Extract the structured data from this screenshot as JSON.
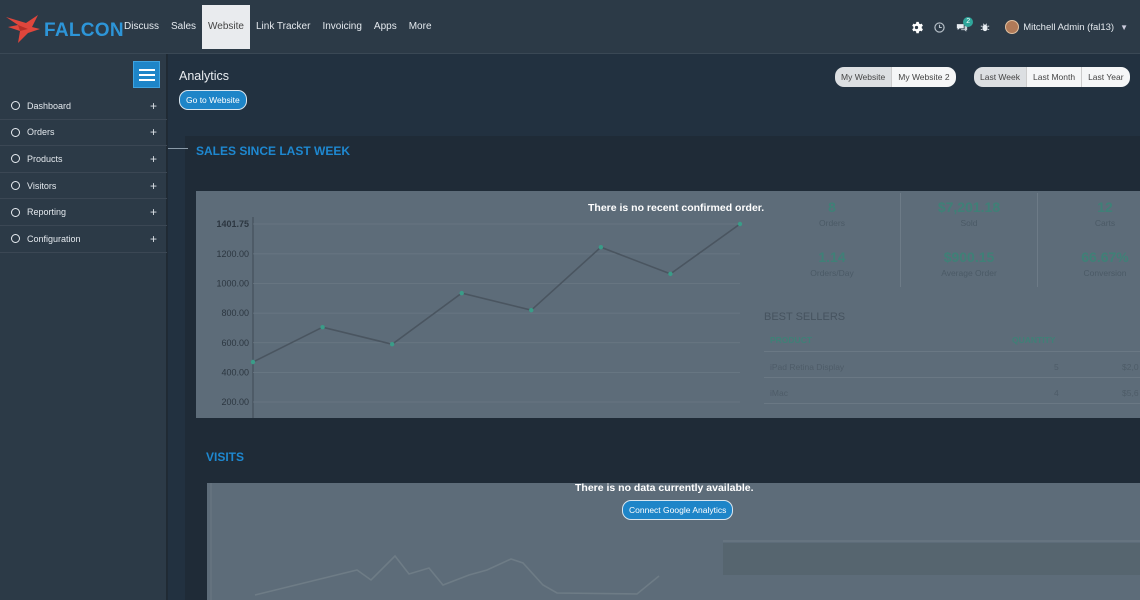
{
  "brand": {
    "name": "FALCON",
    "accent": "#2d95d8",
    "mark_color": "#e0463c"
  },
  "nav": {
    "items": [
      {
        "label": "Discuss",
        "active": false
      },
      {
        "label": "Sales",
        "active": false
      },
      {
        "label": "Website",
        "active": true
      },
      {
        "label": "Link Tracker",
        "active": false
      },
      {
        "label": "Invoicing",
        "active": false
      },
      {
        "label": "Apps",
        "active": false
      },
      {
        "label": "More",
        "active": false
      }
    ]
  },
  "systray": {
    "icons": [
      "gear-icon",
      "clock-icon",
      "chat-icon",
      "bug-icon"
    ],
    "messages_count": "2",
    "user_name": "Mitchell Admin (fal13)"
  },
  "sidebar": {
    "items": [
      {
        "label": "Dashboard"
      },
      {
        "label": "Orders"
      },
      {
        "label": "Products"
      },
      {
        "label": "Visitors"
      },
      {
        "label": "Reporting"
      },
      {
        "label": "Configuration"
      }
    ]
  },
  "main": {
    "title": "Analytics",
    "goto_label": "Go to Website",
    "website_buttons": [
      {
        "label": "My Website",
        "active": true
      },
      {
        "label": "My Website 2",
        "active": false
      }
    ],
    "period_buttons": [
      {
        "label": "Last Week",
        "active": true
      },
      {
        "label": "Last Month",
        "active": false
      },
      {
        "label": "Last Year",
        "active": false
      }
    ]
  },
  "sales": {
    "heading": "SALES SINCE LAST WEEK",
    "overlay_message": "There is no recent confirmed order.",
    "kpis": [
      {
        "value": "8",
        "label": "Orders"
      },
      {
        "value": "$7,201.18",
        "label": "Sold"
      },
      {
        "value": "12",
        "label": "Carts"
      },
      {
        "value": "1.14",
        "label": "Orders/Day"
      },
      {
        "value": "$900.15",
        "label": "Average Order"
      },
      {
        "value": "66.67%",
        "label": "Conversion"
      }
    ],
    "best_sellers": {
      "title": "BEST SELLERS",
      "columns": [
        "PRODUCT",
        "QUANTITY"
      ],
      "rows": [
        {
          "product": "iPad Retina Display",
          "quantity": "5",
          "amount": "$2,0"
        },
        {
          "product": "iMac",
          "quantity": "4",
          "amount": "$5,6"
        }
      ]
    }
  },
  "chart_data": {
    "type": "line",
    "title": "",
    "xlabel": "",
    "ylabel": "",
    "ylim": [
      100,
      1401.75
    ],
    "y_ticks": [
      "1401.75",
      "1200.00",
      "1000.00",
      "800.00",
      "600.00",
      "400.00",
      "200.00"
    ],
    "series": [
      {
        "values": [
          470,
          705,
          590,
          935,
          820,
          1245,
          1065,
          1401.75
        ],
        "color": "#3a9c88"
      }
    ],
    "grid": true
  },
  "visits": {
    "heading": "VISITS",
    "overlay_message": "There is no data currently available.",
    "connect_label": "Connect Google Analytics"
  }
}
